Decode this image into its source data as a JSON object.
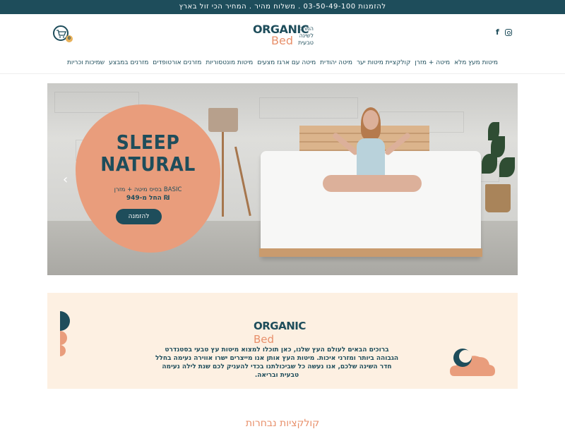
{
  "topbar": {
    "text": "להזמנות 03-50-49-100 . משלוח מהיר . המחיר הכי זול בארץ"
  },
  "header": {
    "logo_word1": "ORGANIC",
    "logo_word2": "Bed",
    "logo_tagline": "המרכז לשינה טבעית",
    "cart_count": "0",
    "social": {
      "facebook": "f"
    }
  },
  "nav": {
    "items": [
      "מיטות מעץ מלא",
      "מיטה + מזרן",
      "קולקציית מיטות יער",
      "מיטה יהודית",
      "מיטה עם ארגז מצעים",
      "מיטות מונטסוריות",
      "מזרנים אורטופדים",
      "מזרנים במבצע",
      "שמיכות וכריות"
    ]
  },
  "hero": {
    "title_line1": "SLEEP",
    "title_line2": "NATURAL",
    "subtitle": "בסיס מיטה + מזרן BASIC",
    "price": "החל מ-949 ₪",
    "cta": "להזמנה"
  },
  "welcome": {
    "logo_word1": "ORGANIC",
    "logo_word2": "Bed",
    "text": "ברוכים הבאים לעולם העץ שלנו, כאן תוכלו למצוא מיטות עץ טבעי בסטנדרט הגבוהה ביותר ומזרני איכות. מיטות העץ אותן אנו מייצרים ישרו אווירה נעימה בחלל חדר השינה שלכם, אנו נעשה כל שביכולתנו בכדי להעניק לכם שנת לילה נעימה טבעית ובריאה."
  },
  "section": {
    "title": "קולקציות נבחרות"
  },
  "colors": {
    "primary": "#1e4d5b",
    "accent": "#e99d7c",
    "cream": "#fdf0e2"
  }
}
